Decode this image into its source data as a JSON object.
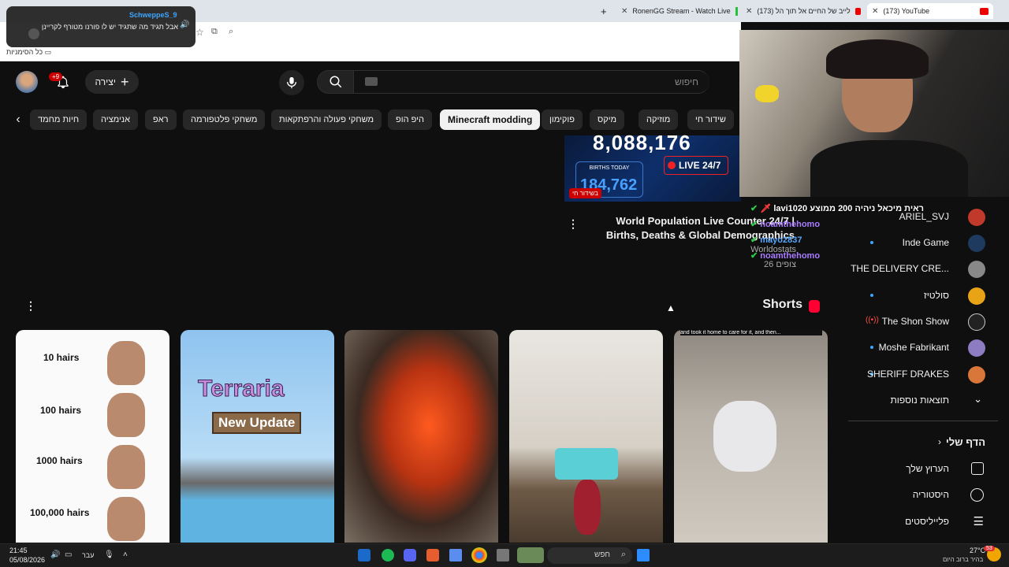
{
  "browser": {
    "tabs": [
      {
        "title": "(173) YouTube",
        "active": true
      },
      {
        "title": "(173) לייב של החיים אל תוך הל"
      },
      {
        "title": "RonenGG Stream - Watch Live"
      }
    ],
    "bookmarks_label": "כל הסימניות"
  },
  "chat_popup": {
    "username": "SchweppeS_9",
    "message": "אבל תגיד מה שתגיד יש לו פורנו מטורף לקריינן"
  },
  "youtube": {
    "search_placeholder": "חיפוש",
    "create_label": "יצירה",
    "notification_count": "+9",
    "chips": [
      "שידור חי",
      "מוזיקה",
      "מיקס",
      "פוקימון",
      "Minecraft modding",
      "היפ הופ",
      "משחקי פעולה והרפתקאות",
      "משחקי פלטפורמה",
      "ראפ",
      "אנימציה",
      "חיות מחמד"
    ],
    "live_video": {
      "big_number": "8,088,176",
      "births_label": "BIRTHS TODAY",
      "births_value": "184,762",
      "live_tag": "LIVE 24/7",
      "live_badge": "בשידור חי",
      "title": "World Population Live Counter 24/7 | Births, Deaths & Global Demographics",
      "channel": "Worldostats",
      "views": "26 צופים"
    },
    "shorts_title": "Shorts",
    "shorts": [
      {
        "lines": [
          "10 hairs",
          "100 hairs",
          "1000 hairs",
          "100,000 hairs"
        ]
      },
      {
        "lines": [
          "Terraria",
          "New Update"
        ]
      },
      {
        "lines": []
      },
      {
        "lines": []
      },
      {
        "lines": [
          "and took it home to care for it, and then..."
        ]
      }
    ]
  },
  "sidebar": {
    "subscriptions": [
      {
        "label": "ARIEL_SVJ",
        "dot": false,
        "color": "#c0392b"
      },
      {
        "label": "Inde Game",
        "dot": true,
        "color": "#1e3a5f"
      },
      {
        "label": "THE DELIVERY CRE...",
        "dot": false,
        "color": "#888888"
      },
      {
        "label": "סולטיז",
        "dot": true,
        "color": "#e8a317"
      },
      {
        "label": "The Shon Show",
        "dot": false,
        "live": true,
        "color": "#222222"
      },
      {
        "label": "Moshe Fabrikant",
        "dot": true,
        "color": "#8e7cc3"
      },
      {
        "label": "SHERIFF DRAKES",
        "dot": true,
        "color": "#d9773a"
      }
    ],
    "show_more": "תוצאות נוספות",
    "you_section": "הדף שלי",
    "you_items": [
      "הערוץ שלך",
      "היסטוריה",
      "פלייליסטים"
    ]
  },
  "stream_chat": [
    {
      "user": "lavi1020",
      "text": "ראית מיכאל ניהיה 200 ממוצע"
    },
    {
      "user": "noamthehomo",
      "text": ""
    },
    {
      "user": "mayo2837",
      "text": ""
    },
    {
      "user": "noamthehomo",
      "text": ""
    }
  ],
  "taskbar": {
    "time": "21:45",
    "date": "05/08/2026",
    "lang": "עבר",
    "search": "חפש",
    "weather_temp": "27°C",
    "weather_desc": "בהיר ברוב היום",
    "weather_badge": "53"
  }
}
